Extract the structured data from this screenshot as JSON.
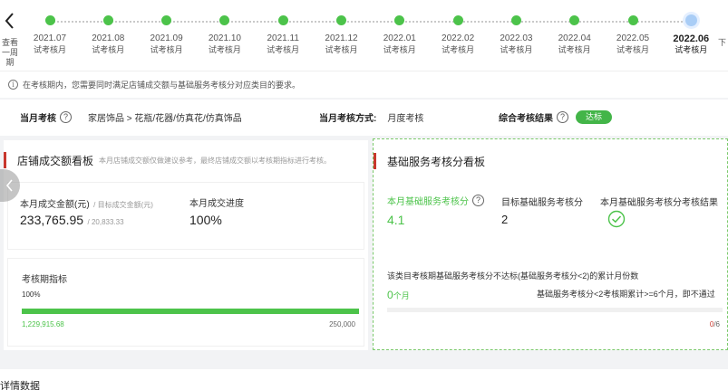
{
  "timeline": {
    "prev_label": "查看\n一周期",
    "next_label": "下",
    "months": [
      {
        "date": "2021.07",
        "status": "试考核月",
        "active": false
      },
      {
        "date": "2021.08",
        "status": "试考核月",
        "active": false
      },
      {
        "date": "2021.09",
        "status": "试考核月",
        "active": false
      },
      {
        "date": "2021.10",
        "status": "试考核月",
        "active": false
      },
      {
        "date": "2021.11",
        "status": "试考核月",
        "active": false
      },
      {
        "date": "2021.12",
        "status": "试考核月",
        "active": false
      },
      {
        "date": "2022.01",
        "status": "试考核月",
        "active": false
      },
      {
        "date": "2022.02",
        "status": "试考核月",
        "active": false
      },
      {
        "date": "2022.03",
        "status": "试考核月",
        "active": false
      },
      {
        "date": "2022.04",
        "status": "试考核月",
        "active": false
      },
      {
        "date": "2022.05",
        "status": "试考核月",
        "active": false
      },
      {
        "date": "2022.06",
        "status": "试考核月",
        "active": true
      }
    ]
  },
  "notice": {
    "text": "在考核期内，您需要同时满足店铺成交额与基础服务考核分对应类目的要求。"
  },
  "summary": {
    "month_exam_label": "当月考核",
    "category": "家居饰品 > 花瓶/花器/仿真花/仿真饰品",
    "method_label": "当月考核方式:",
    "method_value": "月度考核",
    "result_label": "综合考核结果",
    "result_value": "达标"
  },
  "gmv_panel": {
    "title": "店铺成交额看板",
    "subtitle": "本月店铺成交额仅做建议参考，最终店铺成交额以考核期指标进行考核。",
    "amount_label": "本月成交金额(元)",
    "target_label": "/ 目标成交金额(元)",
    "amount_value": "233,765.95",
    "target_value": "/ 20,833.33",
    "progress_label": "本月成交进度",
    "progress_value": "100%",
    "period_label": "考核期指标",
    "period_percent": "100%",
    "period_progress_fraction": 1.0,
    "period_current": "1,229,915.68",
    "period_target": "250,000"
  },
  "service_panel": {
    "title": "基础服务考核分看板",
    "score_label": "本月基础服务考核分",
    "score_value": "4.1",
    "target_label": "目标基础服务考核分",
    "target_value": "2",
    "result_label": "本月基础服务考核分考核结果",
    "fail_months_title": "该类目考核期基础服务考核分不达标(基础服务考核分<2)的累计月份数",
    "fail_months_value": "0",
    "fail_months_unit": "个月",
    "rule_text": "基础服务考核分<2考核期累计>=6个月，即不通过",
    "fail_count_current": "0",
    "fail_count_total": "/6"
  },
  "bottom": {
    "title": "详情数据"
  },
  "colors": {
    "accent_green": "#4cc34a",
    "accent_red": "#c8372d",
    "active_dot": "#a9cdf6"
  }
}
